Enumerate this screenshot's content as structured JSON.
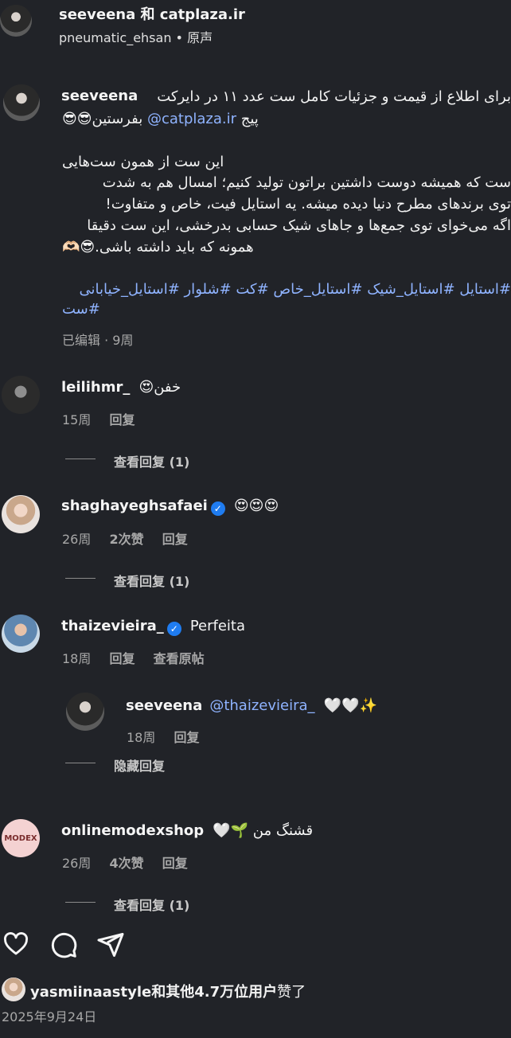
{
  "header": {
    "title": "seeveena 和 catplaza.ir",
    "subtitle_user": "pneumatic_ehsan",
    "subtitle_sep": "•",
    "subtitle_audio": "原声"
  },
  "post": {
    "author": "seeveena",
    "caption_line1": "برای اطلاع از قیمت و جزئیات کامل ست عدد ۱۱ در دایرکت",
    "caption_line2_prefix": "پیج",
    "caption_line2_mention": "@catplaza.ir",
    "caption_line2_suffix": "بفرستین😎😎",
    "caption_p2_1": "این ست از همون ست‌هایی",
    "caption_p2_2": "ست که همیشه دوست داشتین براتون تولید کنیم؛ امسال هم به شدت",
    "caption_p2_3": "توی برندهای مطرح دنیا دیده میشه. یه استایل فیت، خاص و متفاوت!",
    "caption_p2_4": "اگه می‌خوای توی جمع‌ها و جاهای شیک حسابی بدرخشی، این ست دقیقا",
    "caption_p2_5": "همونه که باید داشته باشی.😎🫶🏻",
    "hashtags_line1": "#استایل #استایل_شیک #استایل_خاص #کت #شلوار #استایل_خیابانی",
    "hashtags_line2": "#ست",
    "edited": "已编辑 · 9周"
  },
  "comments": [
    {
      "user": "leilihmr_",
      "text": "خفن😍",
      "time": "15周",
      "reply": "回复",
      "view_replies": "查看回复 (1)"
    },
    {
      "user": "shaghayeghsafaei",
      "verified": true,
      "text": "😍😍😍",
      "time": "26周",
      "likes": "2次赞",
      "reply": "回复",
      "view_replies": "查看回复 (1)"
    },
    {
      "user": "thaizevieira_",
      "verified": true,
      "text": "Perfeita",
      "time": "18周",
      "reply": "回复",
      "view_original": "查看原帖",
      "replies": [
        {
          "user": "seeveena",
          "mention": "@thaizevieira_",
          "text": "🤍🤍✨",
          "time": "18周",
          "reply": "回复"
        }
      ],
      "hide_replies": "隐藏回复"
    },
    {
      "user": "onlinemodexshop",
      "text": "قشنگ من 🌱🤍",
      "time": "26周",
      "likes": "4次赞",
      "reply": "回复",
      "view_replies": "查看回复 (1)",
      "avatar_text": "MODEX"
    }
  ],
  "actions": {
    "icons": [
      "heart-icon",
      "comment-icon",
      "share-icon"
    ]
  },
  "likes_summary": {
    "user": "yasmiinaastyle",
    "rest": "和其他4.7万位用户",
    "suffix": "赞了"
  },
  "date": "2025年9月24日"
}
